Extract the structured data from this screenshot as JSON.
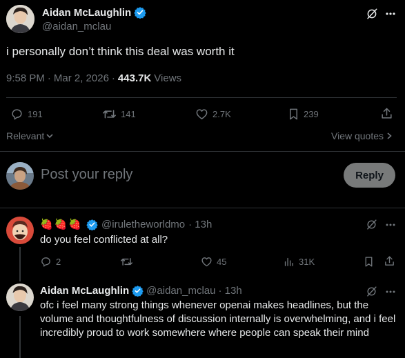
{
  "main_tweet": {
    "author_name": "Aidan McLaughlin",
    "author_handle": "@aidan_mclau",
    "text": "i personally don’t think this deal was worth it",
    "time": "9:58 PM",
    "date": "Mar 2, 2026",
    "separator": "·",
    "views_count": "443.7K",
    "views_label": "Views",
    "stats": {
      "replies": "191",
      "reposts": "141",
      "likes": "2.7K",
      "bookmarks": "239"
    }
  },
  "controls": {
    "sort_label": "Relevant",
    "view_quotes_label": "View quotes"
  },
  "composer": {
    "placeholder": "Post your reply",
    "reply_button": "Reply"
  },
  "reply_1": {
    "display_name_emoji": "🍓🍓🍓",
    "author_handle": "@iruletheworldmo",
    "time": "· 13h",
    "text": "do you feel conflicted at all?",
    "stats": {
      "replies": "2",
      "reposts": "",
      "likes": "45",
      "views": "31K"
    }
  },
  "reply_2": {
    "author_name": "Aidan McLaughlin",
    "author_handle": "@aidan_mclau",
    "time": "· 13h",
    "text": "ofc i feel many strong things whenever openai makes headlines, but the volume and thoughtfulness of discussion internally is overwhelming, and i feel incredibly proud to work somewhere where people can speak their mind"
  },
  "colors": {
    "background": "#000000",
    "text": "#e7e9ea",
    "muted": "#71767b",
    "divider": "#2f3336",
    "verified": "#1d9bf0",
    "reply_button": "#787a7a"
  }
}
